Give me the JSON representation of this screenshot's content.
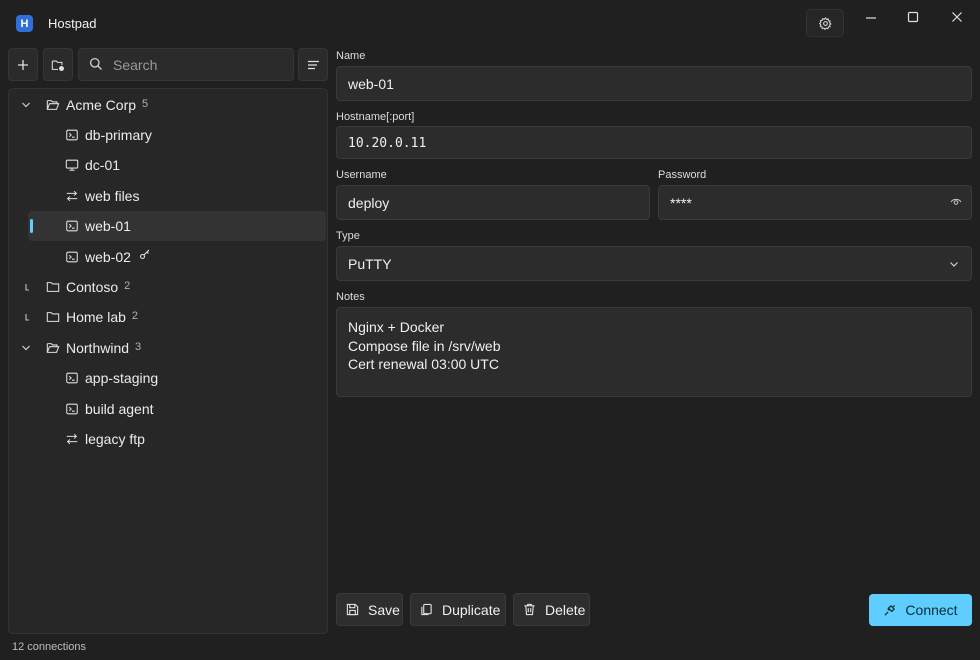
{
  "app": {
    "title": "Hostpad",
    "logo_letter": "H",
    "accent": "#60cdff"
  },
  "sidebar": {
    "search_placeholder": "Search",
    "groups": [
      {
        "name": "Acme Corp",
        "count": "5",
        "expanded": true,
        "items": [
          {
            "label": "db-primary",
            "icon": "terminal-icon"
          },
          {
            "label": "dc-01",
            "icon": "monitor-icon"
          },
          {
            "label": "web files",
            "icon": "transfer-icon"
          },
          {
            "label": "web-01",
            "icon": "terminal-icon",
            "selected": true
          },
          {
            "label": "web-02",
            "icon": "terminal-icon",
            "key": true
          }
        ]
      },
      {
        "name": "Contoso",
        "count": "2",
        "expanded": false
      },
      {
        "name": "Home lab",
        "count": "2",
        "expanded": false
      },
      {
        "name": "Northwind",
        "count": "3",
        "expanded": true,
        "items": [
          {
            "label": "app-staging",
            "icon": "terminal-icon"
          },
          {
            "label": "build agent",
            "icon": "terminal-icon"
          },
          {
            "label": "legacy ftp",
            "icon": "transfer-icon"
          }
        ]
      }
    ]
  },
  "form": {
    "name_label": "Name",
    "name_value": "web-01",
    "hostname_label": "Hostname[:port]",
    "hostname_value": "10.20.0.11",
    "username_label": "Username",
    "username_value": "deploy",
    "password_label": "Password",
    "password_value": "****",
    "type_label": "Type",
    "type_value": "PuTTY",
    "notes_label": "Notes",
    "notes_value": "Nginx + Docker\nCompose file in /srv/web\nCert renewal 03:00 UTC"
  },
  "actions": {
    "save_label": "Save",
    "duplicate_label": "Duplicate",
    "delete_label": "Delete",
    "connect_label": "Connect"
  },
  "status": {
    "text": "12 connections"
  }
}
